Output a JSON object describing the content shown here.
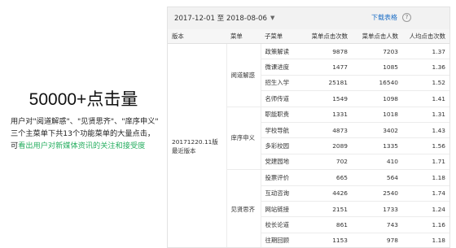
{
  "left": {
    "headline": "50000+点击量",
    "line1": "用户对\"阅道解惑\"、\"见贤思齐\"、\"庠序申义\"",
    "line2": "三个主菜单下共13个功能菜单的大量点击，",
    "line3_prefix": "可",
    "line3_highlight": "看出用户对新媒体资讯的关注和接受度"
  },
  "report": {
    "date_range": "2017-12-01 至 2018-08-06",
    "download_label": "下载表格",
    "help_glyph": "?",
    "columns": [
      "版本",
      "菜单",
      "子菜单",
      "菜单点击次数",
      "菜单点击人数",
      "人均点击次数"
    ],
    "version_line1": "20171220.11版",
    "version_line2": "最近版本",
    "groups": [
      {
        "name": "阅道解惑",
        "rows": [
          [
            "政策解读",
            "9878",
            "7203",
            "1.37"
          ],
          [
            "微课进度",
            "1477",
            "1085",
            "1.36"
          ],
          [
            "招生入学",
            "25181",
            "16540",
            "1.52"
          ],
          [
            "名师传道",
            "1549",
            "1098",
            "1.41"
          ]
        ]
      },
      {
        "name": "庠序申义",
        "rows": [
          [
            "职能职责",
            "1331",
            "1018",
            "1.31"
          ],
          [
            "学校导航",
            "4873",
            "3402",
            "1.43"
          ],
          [
            "多彩校园",
            "2089",
            "1335",
            "1.56"
          ],
          [
            "党建园地",
            "702",
            "410",
            "1.71"
          ]
        ]
      },
      {
        "name": "见贤思齐",
        "rows": [
          [
            "投票评价",
            "665",
            "564",
            "1.18"
          ],
          [
            "互动咨询",
            "4426",
            "2540",
            "1.74"
          ],
          [
            "网站链接",
            "2151",
            "1733",
            "1.24"
          ],
          [
            "校长论道",
            "861",
            "743",
            "1.16"
          ],
          [
            "往期回顾",
            "1153",
            "978",
            "1.18"
          ]
        ]
      }
    ]
  }
}
